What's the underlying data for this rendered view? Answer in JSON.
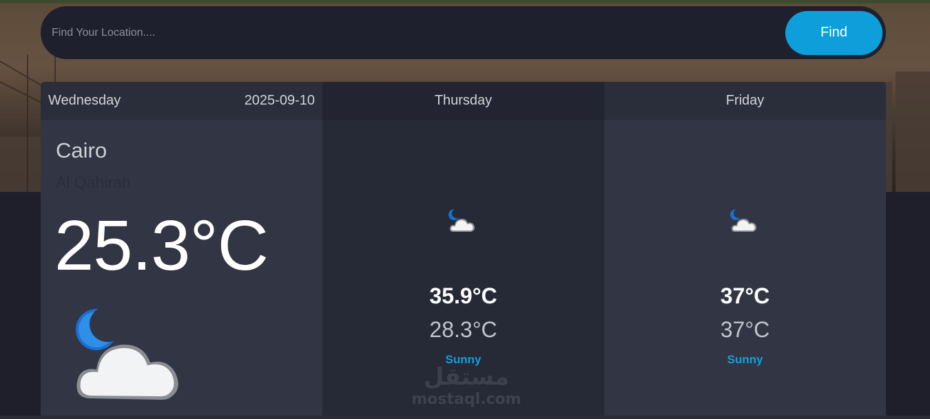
{
  "search": {
    "placeholder": "Find Your Location....",
    "button_label": "Find"
  },
  "today": {
    "day": "Wednesday",
    "date": "2025-09-10",
    "city": "Cairo",
    "region": "Al Qahirah",
    "temperature": "25.3°C",
    "icon": "moon-cloud-icon"
  },
  "forecast": [
    {
      "day": "Thursday",
      "max": "35.9°C",
      "min": "28.3°C",
      "condition": "Sunny",
      "icon": "moon-cloud-icon"
    },
    {
      "day": "Friday",
      "max": "37°C",
      "min": "37°C",
      "condition": "Sunny",
      "icon": "moon-cloud-icon"
    }
  ],
  "watermark": {
    "arabic": "مستقل",
    "latin": "mostaql.com"
  },
  "colors": {
    "accent": "#0e9fdb",
    "background": "#1e1f2b",
    "card_light": "#323644",
    "card_dark": "#262936"
  }
}
